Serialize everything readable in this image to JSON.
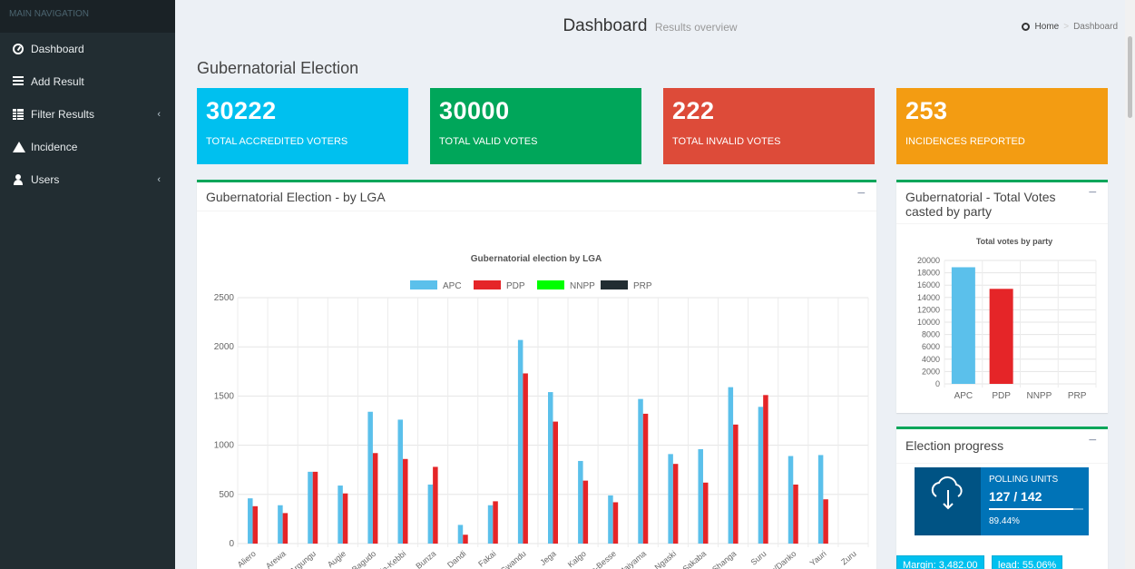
{
  "sidebar": {
    "header": "MAIN NAVIGATION",
    "items": [
      {
        "label": "Dashboard",
        "icon": "dashboard-icon"
      },
      {
        "label": "Add Result",
        "icon": "list-icon"
      },
      {
        "label": "Filter Results",
        "icon": "table-icon"
      },
      {
        "label": "Incidence",
        "icon": "warning-icon"
      },
      {
        "label": "Users",
        "icon": "user-icon"
      }
    ]
  },
  "header": {
    "title": "Dashboard",
    "subtitle": "Results overview",
    "breadcrumb": {
      "home": "Home",
      "current": "Dashboard"
    }
  },
  "section_title": "Gubernatorial Election",
  "stats": [
    {
      "value": "30222",
      "label": "TOTAL ACCREDITED VOTERS",
      "color": "#00c0ef"
    },
    {
      "value": "30000",
      "label": "TOTAL VALID VOTES",
      "color": "#00a65a"
    },
    {
      "value": "222",
      "label": "TOTAL INVALID VOTES",
      "color": "#dd4b39"
    },
    {
      "value": "253",
      "label": "INCIDENCES REPORTED",
      "color": "#f39c12"
    }
  ],
  "lga_box": {
    "title": "Gubernatorial Election - by LGA",
    "collapse": "−"
  },
  "party_box": {
    "title": "Gubernatorial - Total Votes casted by party",
    "collapse": "−"
  },
  "progress_box": {
    "title": "Election progress",
    "collapse": "−",
    "label": "POLLING UNITS",
    "value": "127 / 142",
    "percent": "89.44%",
    "percent_value": 89.44,
    "margin": "Margin: 3,482.00",
    "lead": "lead: 55.06%"
  },
  "chart_data": [
    {
      "type": "bar",
      "title": "Gubernatorial election by LGA",
      "categories": [
        "Aliero",
        "Arewa",
        "Argungu",
        "Augie",
        "Bagudo",
        "Birnin-Kebbi",
        "Bunza",
        "Dandi",
        "Fakai",
        "Gwandu",
        "Jega",
        "Kalgo",
        "Koko-Besse",
        "Maiyama",
        "Ngaski",
        "Sakaba",
        "Shanga",
        "Suru",
        "Wasagu/Danko",
        "Yauri",
        "Zuru"
      ],
      "series": [
        {
          "name": "APC",
          "color": "#5bc0eb",
          "values": [
            460,
            390,
            730,
            590,
            1340,
            1260,
            600,
            190,
            390,
            2070,
            1540,
            840,
            490,
            1470,
            910,
            960,
            1590,
            1390,
            890,
            900,
            0
          ]
        },
        {
          "name": "PDP",
          "color": "#e52528",
          "values": [
            380,
            310,
            730,
            510,
            920,
            860,
            780,
            90,
            430,
            1730,
            1240,
            640,
            420,
            1320,
            810,
            620,
            1210,
            1510,
            600,
            450,
            0
          ]
        },
        {
          "name": "NNPP",
          "color": "#00ff00",
          "values": [
            0,
            0,
            0,
            0,
            0,
            0,
            0,
            0,
            0,
            0,
            0,
            0,
            0,
            0,
            0,
            0,
            0,
            0,
            0,
            0,
            0
          ]
        },
        {
          "name": "PRP",
          "color": "#222d32",
          "values": [
            0,
            0,
            0,
            0,
            0,
            0,
            0,
            0,
            0,
            0,
            0,
            0,
            0,
            0,
            0,
            0,
            0,
            0,
            0,
            0,
            0
          ]
        }
      ],
      "ylim": [
        0,
        2500
      ],
      "yticks": [
        0,
        500,
        1000,
        1500,
        2000,
        2500
      ],
      "legend": "top",
      "grid": true
    },
    {
      "type": "bar",
      "title": "Total votes by party",
      "categories": [
        "APC",
        "PDP",
        "NNPP",
        "PRP"
      ],
      "values": [
        18900,
        15400,
        0,
        0
      ],
      "colors": [
        "#5bc0eb",
        "#e52528",
        "#00ff00",
        "#222d32"
      ],
      "ylim": [
        0,
        20000
      ],
      "yticks": [
        0,
        2000,
        4000,
        6000,
        8000,
        10000,
        12000,
        14000,
        16000,
        18000,
        20000
      ],
      "grid": true
    }
  ]
}
